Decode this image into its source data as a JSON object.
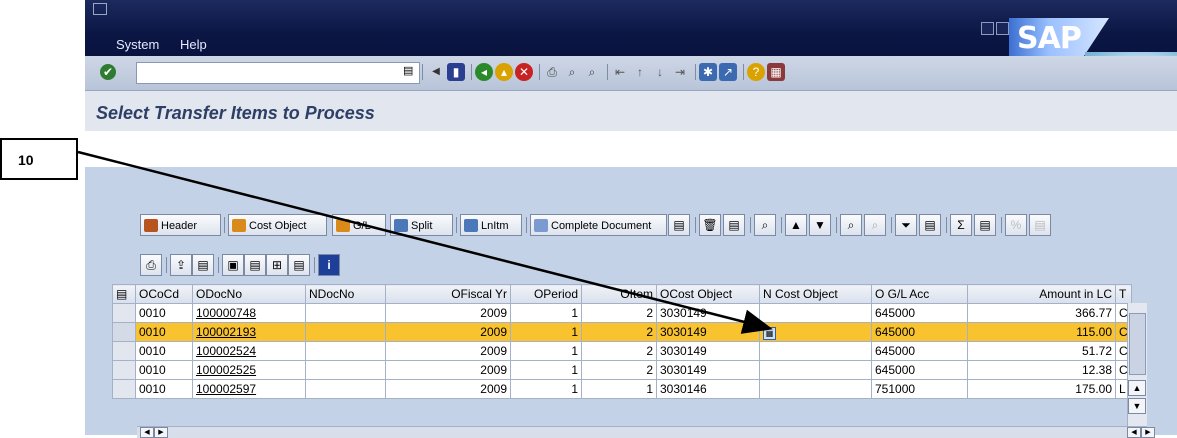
{
  "callout": {
    "label": "10"
  },
  "menu": {
    "system": "System",
    "help": "Help"
  },
  "sap_logo": "SAP",
  "page_title": "Select Transfer Items to Process",
  "alv_toolbar": {
    "header": "Header",
    "cost_object": "Cost Object",
    "gl": "G/L",
    "split": "Split",
    "lnitm": "LnItm",
    "complete_document": "Complete Document"
  },
  "table": {
    "columns": [
      "OCoCd",
      "ODocNo",
      "NDocNo",
      "OFiscal Yr",
      "OPeriod",
      "OItem",
      "OCost Object",
      "N Cost Object",
      "O G/L Acc",
      "Amount in LC",
      "T"
    ],
    "rows": [
      [
        "0010",
        "100000748",
        "",
        "2009",
        "1",
        "2",
        "3030149",
        "",
        "645000",
        "366.77",
        "C"
      ],
      [
        "0010",
        "100002193",
        "",
        "2009",
        "1",
        "2",
        "3030149",
        "",
        "645000",
        "115.00",
        "C"
      ],
      [
        "0010",
        "100002524",
        "",
        "2009",
        "1",
        "2",
        "3030149",
        "",
        "645000",
        "51.72",
        "C"
      ],
      [
        "0010",
        "100002525",
        "",
        "2009",
        "1",
        "2",
        "3030149",
        "",
        "645000",
        "12.38",
        "C"
      ],
      [
        "0010",
        "100002597",
        "",
        "2009",
        "1",
        "1",
        "3030146",
        "",
        "751000",
        "175.00",
        "L"
      ]
    ]
  },
  "colors": {
    "highlight": "#f9c32f",
    "title_blue": "#2e3f66"
  }
}
